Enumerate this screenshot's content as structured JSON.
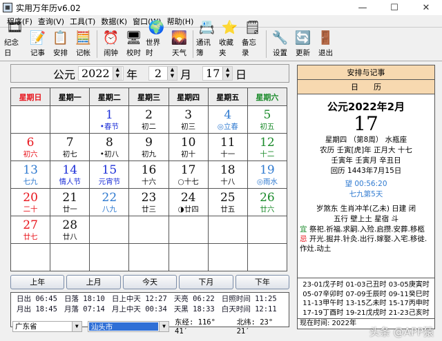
{
  "window": {
    "title": "实用万年历v6.02",
    "minimize": "—",
    "maximize": "☐",
    "close": "✕"
  },
  "menu": [
    "程序(F)",
    "查询(V)",
    "工具(T)",
    "数据(K)",
    "窗口(W)",
    "帮助(H)"
  ],
  "toolbar": [
    [
      {
        "label": "纪念日",
        "icon": "film-icon",
        "glyph": "🎞"
      },
      {
        "label": "记事",
        "icon": "notepad-icon",
        "glyph": "📝"
      },
      {
        "label": "安排",
        "icon": "clock-schedule-icon",
        "glyph": "📋"
      },
      {
        "label": "记帐",
        "icon": "calculator-icon",
        "glyph": "🧮"
      }
    ],
    [
      {
        "label": "闹钟",
        "icon": "alarm-clock-icon",
        "glyph": "⏰"
      },
      {
        "label": "校时",
        "icon": "sync-time-icon",
        "glyph": "🖥"
      },
      {
        "label": "世界时",
        "icon": "globe-icon",
        "glyph": "🌍"
      },
      {
        "label": "天气",
        "icon": "weather-icon",
        "glyph": "🌄"
      }
    ],
    [
      {
        "label": "通讯簿",
        "icon": "address-book-icon",
        "glyph": "📇"
      },
      {
        "label": "收藏夹",
        "icon": "star-icon",
        "glyph": "⭐"
      },
      {
        "label": "备忘录",
        "icon": "memo-icon",
        "glyph": "🗒"
      }
    ],
    [
      {
        "label": "设置",
        "icon": "settings-icon",
        "glyph": "🔧"
      },
      {
        "label": "更新",
        "icon": "update-icon",
        "glyph": "🔄"
      },
      {
        "label": "退出",
        "icon": "exit-icon",
        "glyph": "🚪"
      }
    ]
  ],
  "date": {
    "prefix": "公元",
    "year": "2022",
    "year_label": "年",
    "month": "2",
    "month_label": "月",
    "day": "17",
    "day_label": "日"
  },
  "weekdays": [
    "星期日",
    "星期一",
    "星期二",
    "星期三",
    "星期四",
    "星期五",
    "星期六"
  ],
  "colors": {
    "red": "#e8141c",
    "green": "#1a8a2a",
    "blue": "#1c2fd8",
    "lightblue": "#2f7ad0",
    "black": "#111111",
    "today_bg": "#fef68f",
    "panel_header": "#f7d9b0"
  },
  "weeks": [
    [
      null,
      null,
      {
        "d": "1",
        "l": "•春节",
        "dc": "blue",
        "lc": "blue"
      },
      {
        "d": "2",
        "l": "初二"
      },
      {
        "d": "3",
        "l": "初三"
      },
      {
        "d": "4",
        "l": "◎立春",
        "dc": "lightblue",
        "lc": "lightblue"
      },
      {
        "d": "5",
        "l": "初五",
        "dc": "green",
        "lc": "green"
      }
    ],
    [
      {
        "d": "6",
        "l": "初六",
        "dc": "red",
        "lc": "red"
      },
      {
        "d": "7",
        "l": "初七"
      },
      {
        "d": "8",
        "l": "•初八"
      },
      {
        "d": "9",
        "l": "初九"
      },
      {
        "d": "10",
        "l": "初十"
      },
      {
        "d": "11",
        "l": "十一"
      },
      {
        "d": "12",
        "l": "十二",
        "dc": "green",
        "lc": "green"
      }
    ],
    [
      {
        "d": "13",
        "l": "七九",
        "dc": "lightblue",
        "lc": "lightblue"
      },
      {
        "d": "14",
        "l": "情人节",
        "dc": "blue",
        "lc": "blue"
      },
      {
        "d": "15",
        "l": "元宵节",
        "dc": "blue",
        "lc": "blue"
      },
      {
        "d": "16",
        "l": "十六"
      },
      {
        "d": "17",
        "l": "○十七",
        "today": true
      },
      {
        "d": "18",
        "l": "十八"
      },
      {
        "d": "19",
        "l": "◎雨水",
        "dc": "lightblue",
        "lc": "lightblue"
      }
    ],
    [
      {
        "d": "20",
        "l": "二十",
        "dc": "red",
        "lc": "red"
      },
      {
        "d": "21",
        "l": "廿一"
      },
      {
        "d": "22",
        "l": "八九",
        "dc": "lightblue",
        "lc": "lightblue"
      },
      {
        "d": "23",
        "l": "廿三"
      },
      {
        "d": "24",
        "l": "◑廿四"
      },
      {
        "d": "25",
        "l": "廿五"
      },
      {
        "d": "26",
        "l": "廿六",
        "dc": "green",
        "lc": "green"
      }
    ],
    [
      {
        "d": "27",
        "l": "廿七",
        "dc": "red",
        "lc": "red"
      },
      {
        "d": "28",
        "l": "廿八"
      },
      null,
      null,
      null,
      null,
      null
    ],
    [
      null,
      null,
      null,
      null,
      null,
      null,
      null
    ]
  ],
  "nav": [
    "上年",
    "上月",
    "今天",
    "下月",
    "下年"
  ],
  "sun": [
    [
      "日出",
      "06:45"
    ],
    [
      "日落",
      "18:10"
    ],
    [
      "日上中天",
      "12:27"
    ],
    [
      "天亮",
      "06:22"
    ],
    [
      "日照时间",
      "11:25"
    ]
  ],
  "moon": [
    [
      "月出",
      "18:45"
    ],
    [
      "月落",
      "07:14"
    ],
    [
      "月上中天",
      "00:34"
    ],
    [
      "天黑",
      "18:33"
    ],
    [
      "白天时间",
      "12:11"
    ]
  ],
  "location": {
    "province": "广东省",
    "city": "汕头市",
    "longitude": "东经: 116° 41′",
    "latitude": "北纬: 23° 21′"
  },
  "panel": {
    "header1": "安排与记事",
    "header2": "日　　历",
    "ym": "公元2022年2月",
    "day": "17",
    "lines": [
      "星期四 （第8周） 水瓶座",
      "农历 壬寅[虎]年 正月大 十七",
      "壬寅年 壬寅月 辛丑日",
      "回历 1443年7月15日"
    ],
    "moon_phase": "望 00:56:20",
    "nine": "七九第5天",
    "lines2": [
      "岁煞东 生肖冲羊(乙未) 日建 闭",
      "五行 壁上土  星宿 斗"
    ],
    "yi_label": "宜",
    "yi": "祭祀.祈福.求嗣.入殓.启攒.安葬.移柩",
    "ji_label": "忌",
    "ji": "开光.掘井.针灸.出行.嫁娶.入宅.移徙.作灶.动土",
    "hours": [
      "23-01戊子时 01-03己丑时 03-05庚寅时",
      "05-07辛卯时 07-09壬辰时 09-11癸巳时",
      "11-13甲午时 13-15乙未时 15-17丙申时",
      "17-19丁酉时 19-21戊戌时 21-23己亥时"
    ],
    "now": "现在时间: 2022年"
  },
  "watermark": "头条 @APP猿"
}
